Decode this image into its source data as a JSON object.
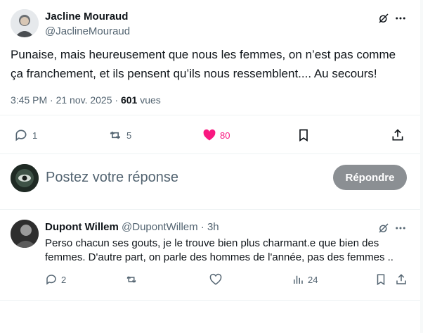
{
  "post": {
    "author_name": "Jacline Mouraud",
    "author_handle": "@JaclineMouraud",
    "text_line1": "Punaise, mais heureusement que nous les femmes, on n’est pas comme",
    "text_line2": "ça franchement, et ils pensent qu’ils nous ressemblent.... Au secours!",
    "time": "3:45 PM · 21 nov. 2025 · ",
    "views_count": "601",
    "views_label": " vues",
    "stats": {
      "replies": "1",
      "reposts": "5",
      "likes": "80"
    },
    "icons": [
      "grok-icon",
      "more-icon",
      "reply-icon",
      "repost-icon",
      "like-icon",
      "bookmark-icon",
      "share-icon"
    ]
  },
  "composer": {
    "placeholder": "Postez votre réponse",
    "reply_button": "Répondre"
  },
  "reply": {
    "author_name": "Dupont Willem",
    "author_handle": "@DupontWillem",
    "sep": " · ",
    "age": "3h",
    "text_line1": "Perso chacun ses gouts, je le trouve bien plus charmant.e que bien des",
    "text_line2": "femmes. D'autre part, on parle des hommes de l'année, pas des femmes ..",
    "stats": {
      "replies": "2",
      "views": "24"
    }
  },
  "colors": {
    "text": "#0f1419",
    "muted": "#536471",
    "like_active": "#f91880",
    "button_disabled": "#8b8f93",
    "divider": "#eff3f4"
  }
}
